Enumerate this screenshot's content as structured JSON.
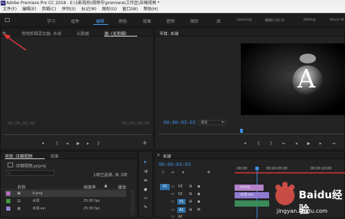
{
  "title_bar": {
    "app_icon_text": "Pr",
    "title": "Adobe Premiere Pro CC 2018 - E:\\1影视后\\视频号\\premiere\\工作区\\压缩视频 *"
  },
  "menu": [
    "文件(F)",
    "编辑(E)",
    "剪辑(C)",
    "序列(S)",
    "标记(M)",
    "图形(G)",
    "窗口(W)",
    "帮助(H)"
  ],
  "workspaces": [
    "学习",
    "组件",
    "编辑",
    "颜色",
    "效果",
    "音频",
    "图形",
    "库",
    "Learning",
    "编辑(CS5.5)",
    "Editing",
    "Stock W"
  ],
  "source_panel": {
    "tabs": [
      "件",
      "音频剪辑混合器: 水球",
      "元数据",
      "源: (无剪辑)"
    ],
    "timecode_left": "00;00;00;00",
    "timecode_right": "00;00;00;00"
  },
  "program_panel": {
    "tab": "节目: 水球",
    "timecode": "00:00:03:03",
    "fit_label": "适合",
    "video_letter": "A"
  },
  "project_panel": {
    "tabs": [
      "项目: 压缩视频",
      "效果"
    ],
    "path": "压缩视频.prproj",
    "selection_info": "1项已选择, 共 3项",
    "columns": [
      "名称",
      "帧速率",
      "媒体开"
    ],
    "items": [
      {
        "name": "A.png",
        "fps": "",
        "color": "#b86fc4"
      },
      {
        "name": "水球",
        "fps": "25.00 fps",
        "color": "#3f9e3f"
      },
      {
        "name": "水球.avi",
        "fps": "25.00 fps",
        "color": "#9a7fd6"
      }
    ]
  },
  "timeline_panel": {
    "tab": "水球",
    "timecode": "00:00:03:03",
    "ruler_labels": [
      ":00:00",
      "00:00:05:00",
      "00:00:10:00"
    ],
    "tracks": [
      {
        "src": "V1",
        "name": "V3"
      },
      {
        "src": "",
        "name": "V2"
      },
      {
        "src": "V1",
        "name": "V1"
      },
      {
        "src": "A1",
        "name": "A1"
      },
      {
        "src": "",
        "name": "A2"
      }
    ],
    "clips": [
      {
        "label": "A.png",
        "color": "#b382c9"
      },
      {
        "label": "水球.avi",
        "color": "#8e7bd1"
      }
    ]
  },
  "watermark": {
    "text": "Baidu经验",
    "url": "jingyan.baidu.com"
  }
}
